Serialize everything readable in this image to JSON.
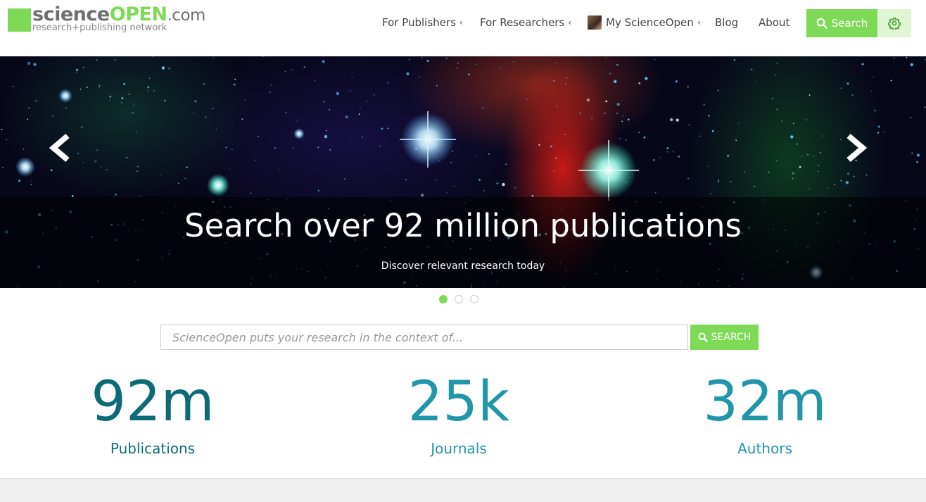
{
  "logo": {
    "word_science": "science",
    "word_open": "OPEN",
    "word_com": ".com",
    "tagline": "research+publishing network"
  },
  "nav": {
    "for_publishers": "For Publishers",
    "for_researchers": "For Researchers",
    "my_scienceopen": "My ScienceOpen",
    "blog": "Blog",
    "about": "About",
    "chevron": "‹",
    "search_label": "Search"
  },
  "hero": {
    "title": "Search over 92 million publications",
    "subtitle": "Discover relevant research today",
    "slide_count": 3,
    "active_slide": 1
  },
  "search": {
    "placeholder": "ScienceOpen puts your research in the context of...",
    "button_label": "SEARCH"
  },
  "stats": [
    {
      "value": "92m",
      "label": "Publications",
      "color": "#0e6b75"
    },
    {
      "value": "25k",
      "label": "Journals",
      "color": "#2196a8"
    },
    {
      "value": "32m",
      "label": "Authors",
      "color": "#2196a8"
    }
  ],
  "colors": {
    "accent": "#7ed957",
    "accent_light": "#dff5d4",
    "logo_gray": "#707070"
  }
}
